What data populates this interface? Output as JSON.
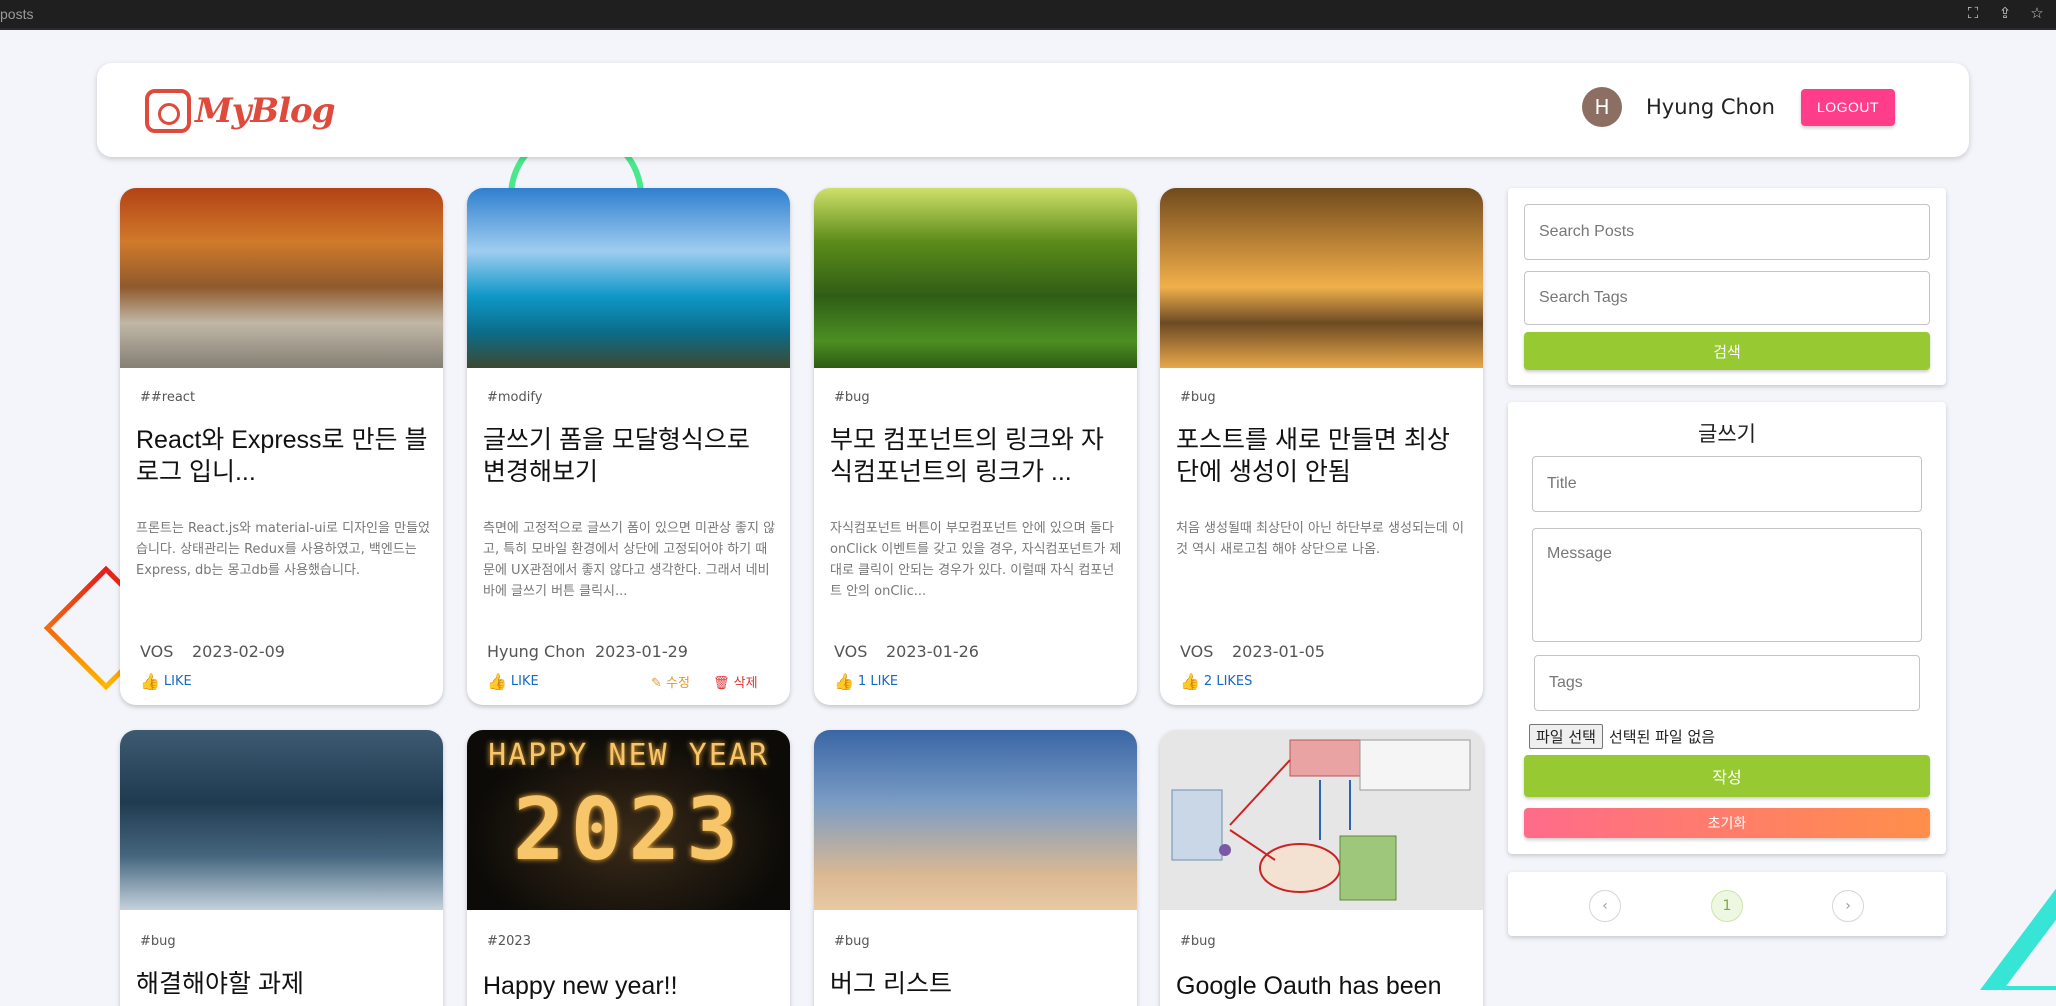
{
  "browser": {
    "url": "posts",
    "icons": [
      "translate-icon",
      "share-icon",
      "star-icon"
    ]
  },
  "header": {
    "logo_text": "MyBlog",
    "avatar_initial": "H",
    "user_name": "Hyung Chon",
    "logout_label": "LOGOUT"
  },
  "colors": {
    "accent_pink": "#ff3d8b",
    "accent_green": "#97c933",
    "link_blue": "#1769c2"
  },
  "posts": [
    {
      "image": "autumn-road",
      "tag": "##react",
      "title": "React와 Express로 만든 블로그 입니...",
      "message": "프론트는 React.js와 material-ui로 디자인을 만들었습니다. 상태관리는 Redux를 사용하였고, 백엔드는 Express, db는 몽고db를 사용했습니다.",
      "author": "VOS",
      "date": "2023-02-09",
      "likes": "LIKE"
    },
    {
      "image": "tropical-sea",
      "tag": "#modify",
      "title": "글쓰기 폼을 모달형식으로 변경해보기",
      "message": "측면에 고정적으로 글쓰기 폼이 있으면 미관상 좋지 않고, 특히 모바일 환경에서 상단에 고정되어야 하기 때문에 UX관점에서 좋지 않다고 생각한다. 그래서 네비바에 글쓰기 버튼 클릭시...",
      "author": "Hyung Chon",
      "date": "2023-01-29",
      "likes": "LIKE",
      "edit_label": "수정",
      "delete_label": "삭제"
    },
    {
      "image": "forest",
      "tag": "#bug",
      "title": "부모 컴포넌트의 링크와 자식컴포넌트의 링크가 ...",
      "message": "자식컴포넌트 버튼이 부모컴포넌트 안에 있으며 둘다 onClick 이벤트를 갖고 있을 경우, 자식컴포넌트가 제대로 클릭이 안되는 경우가 있다. 이럴때 자식 컴포넌트 안의 onClic...",
      "author": "VOS",
      "date": "2023-01-26",
      "likes": "1 LIKE"
    },
    {
      "image": "sunset-lake",
      "tag": "#bug",
      "title": "포스트를 새로 만들면 최상단에 생성이 안됨",
      "message": "처음 생성될때 최상단이 아닌 하단부로 생성되는데 이것 역시 새로고침 해야 상단으로 나옴.",
      "author": "VOS",
      "date": "2023-01-05",
      "likes": "2 LIKES"
    },
    {
      "image": "snow-forest",
      "tag": "#bug",
      "title": "해결해야할 과제"
    },
    {
      "image": "new-year",
      "tag": "#2023",
      "title": "Happy new year!!",
      "image_text_1": "HAPPY NEW YEAR",
      "image_text_2": "2023"
    },
    {
      "image": "sky-clouds",
      "tag": "#bug",
      "title": "버그 리스트"
    },
    {
      "image": "oauth-diagram",
      "tag": "#bug",
      "title": "Google Oauth has been"
    }
  ],
  "search": {
    "posts_placeholder": "Search Posts",
    "tags_placeholder": "Search Tags",
    "button_label": "검색"
  },
  "form": {
    "heading": "글쓰기",
    "title_placeholder": "Title",
    "message_placeholder": "Message",
    "tags_placeholder": "Tags",
    "file_button_label": "파일 선택",
    "file_status": "선택된 파일 없음",
    "submit_label": "작성",
    "reset_label": "초기화"
  },
  "pagination": {
    "prev": "‹",
    "current_page": "1",
    "next": "›"
  }
}
